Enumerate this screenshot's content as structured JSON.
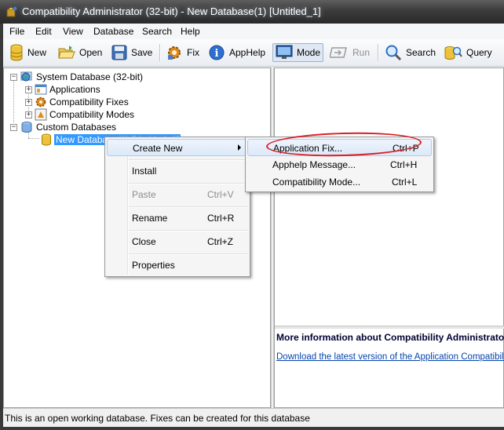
{
  "window": {
    "title": "Compatibility Administrator (32-bit) - New Database(1) [Untitled_1]"
  },
  "menubar": [
    "File",
    "Edit",
    "View",
    "Database",
    "Search",
    "Help"
  ],
  "toolbar": {
    "new": "New",
    "open": "Open",
    "save": "Save",
    "fix": "Fix",
    "apphelp": "AppHelp",
    "mode": "Mode",
    "run": "Run",
    "search": "Search",
    "query": "Query"
  },
  "tree": {
    "system_db": "System Database (32-bit)",
    "applications": "Applications",
    "compat_fixes": "Compatibility Fixes",
    "compat_modes": "Compatibility Modes",
    "custom_dbs": "Custom Databases",
    "new_db": "New Database(1) [Untitled_1]"
  },
  "context_menu": {
    "items": [
      {
        "label": "Create New",
        "shortcut": ""
      },
      {
        "label": "Install",
        "shortcut": ""
      },
      {
        "label": "Paste",
        "shortcut": "Ctrl+V"
      },
      {
        "label": "Rename",
        "shortcut": "Ctrl+R"
      },
      {
        "label": "Close",
        "shortcut": "Ctrl+Z"
      },
      {
        "label": "Properties",
        "shortcut": ""
      }
    ]
  },
  "submenu": {
    "items": [
      {
        "label": "Application Fix...",
        "shortcut": "Ctrl+P"
      },
      {
        "label": "Apphelp Message...",
        "shortcut": "Ctrl+H"
      },
      {
        "label": "Compatibility Mode...",
        "shortcut": "Ctrl+L"
      }
    ]
  },
  "info": {
    "title": "More information about Compatibility Administrator",
    "link": "Download the latest version of the Application Compatibility Toolkit"
  },
  "status": {
    "text": "This is an open working database. Fixes can be created for this database"
  },
  "colors": {
    "selection": "#3399ff",
    "annotation": "#d81e28",
    "link": "#0645ad"
  }
}
